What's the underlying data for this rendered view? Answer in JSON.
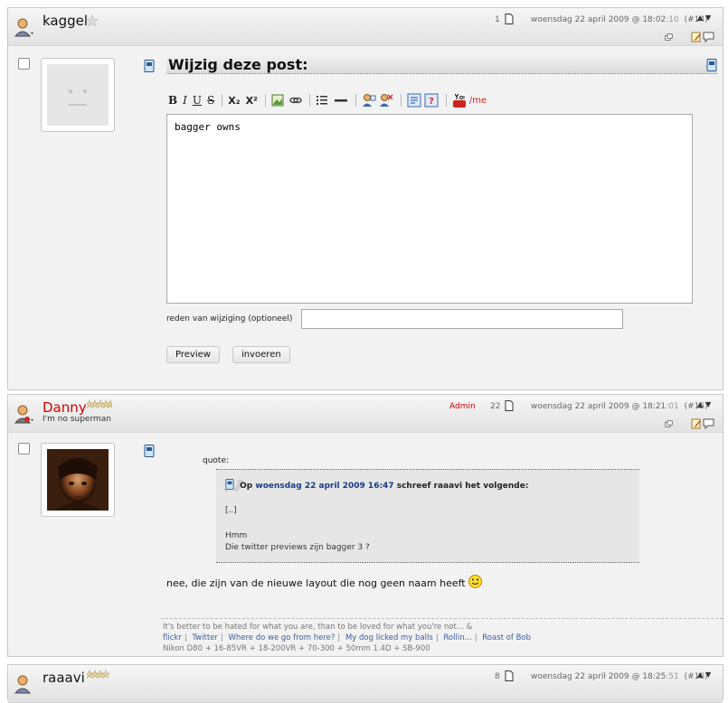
{
  "post1": {
    "username": "kaggel",
    "post_count": "1",
    "date_prefix": "woensdag 22 april 2009 @ 18:02",
    "date_seconds": ":10",
    "post_number": "(#14)",
    "edit_title": "Wijzig deze post:",
    "toolbar": {
      "bold": "B",
      "italic": "I",
      "underline": "U",
      "strike": "S",
      "subscript": "X₂",
      "superscript": "X²",
      "me": "/me"
    },
    "textarea_value": "bagger owns",
    "reason_label": "reden van wijziging (optioneel)",
    "reason_value": "",
    "preview_button": "Preview",
    "submit_button": "invoeren"
  },
  "post2": {
    "username": "Danny",
    "user_title": "I'm no superman",
    "role": "Admin",
    "post_count": "22",
    "date_prefix": "woensdag 22 april 2009 @ 18:21",
    "date_seconds": ":01",
    "post_number": "(#15)",
    "quote_label": "quote:",
    "quote_op": "Op",
    "quote_date": "woensdag 22 april 2009 16:47",
    "quote_wrote": "schreef raaavi het volgende:",
    "quote_line1": "[..]",
    "quote_line2": "Hmm",
    "quote_line3": "Die twitter previews zijn bagger 3 ?",
    "message": "nee, die zijn van de nieuwe layout die nog geen naam heeft",
    "signature": {
      "quote": "It's better to be hated for what you are, than to be loved for what you're not... &",
      "links": [
        "flickr",
        "Twitter",
        "Where do we go from here?",
        "My dog licked my balls",
        "Rollin...",
        "Roast of Bob"
      ],
      "gear": "Nikon D80 + 16-85VR + 18-200VR + 70-300 + 50mm 1.4D + SB-900"
    }
  },
  "post3": {
    "username": "raaavi",
    "post_count": "8",
    "date_prefix": "woensdag 22 april 2009 @ 18:25",
    "date_seconds": ":51",
    "post_number": "(#16)"
  },
  "colors": {
    "admin_red": "#d40000",
    "link_blue": "#1a3a8a"
  }
}
